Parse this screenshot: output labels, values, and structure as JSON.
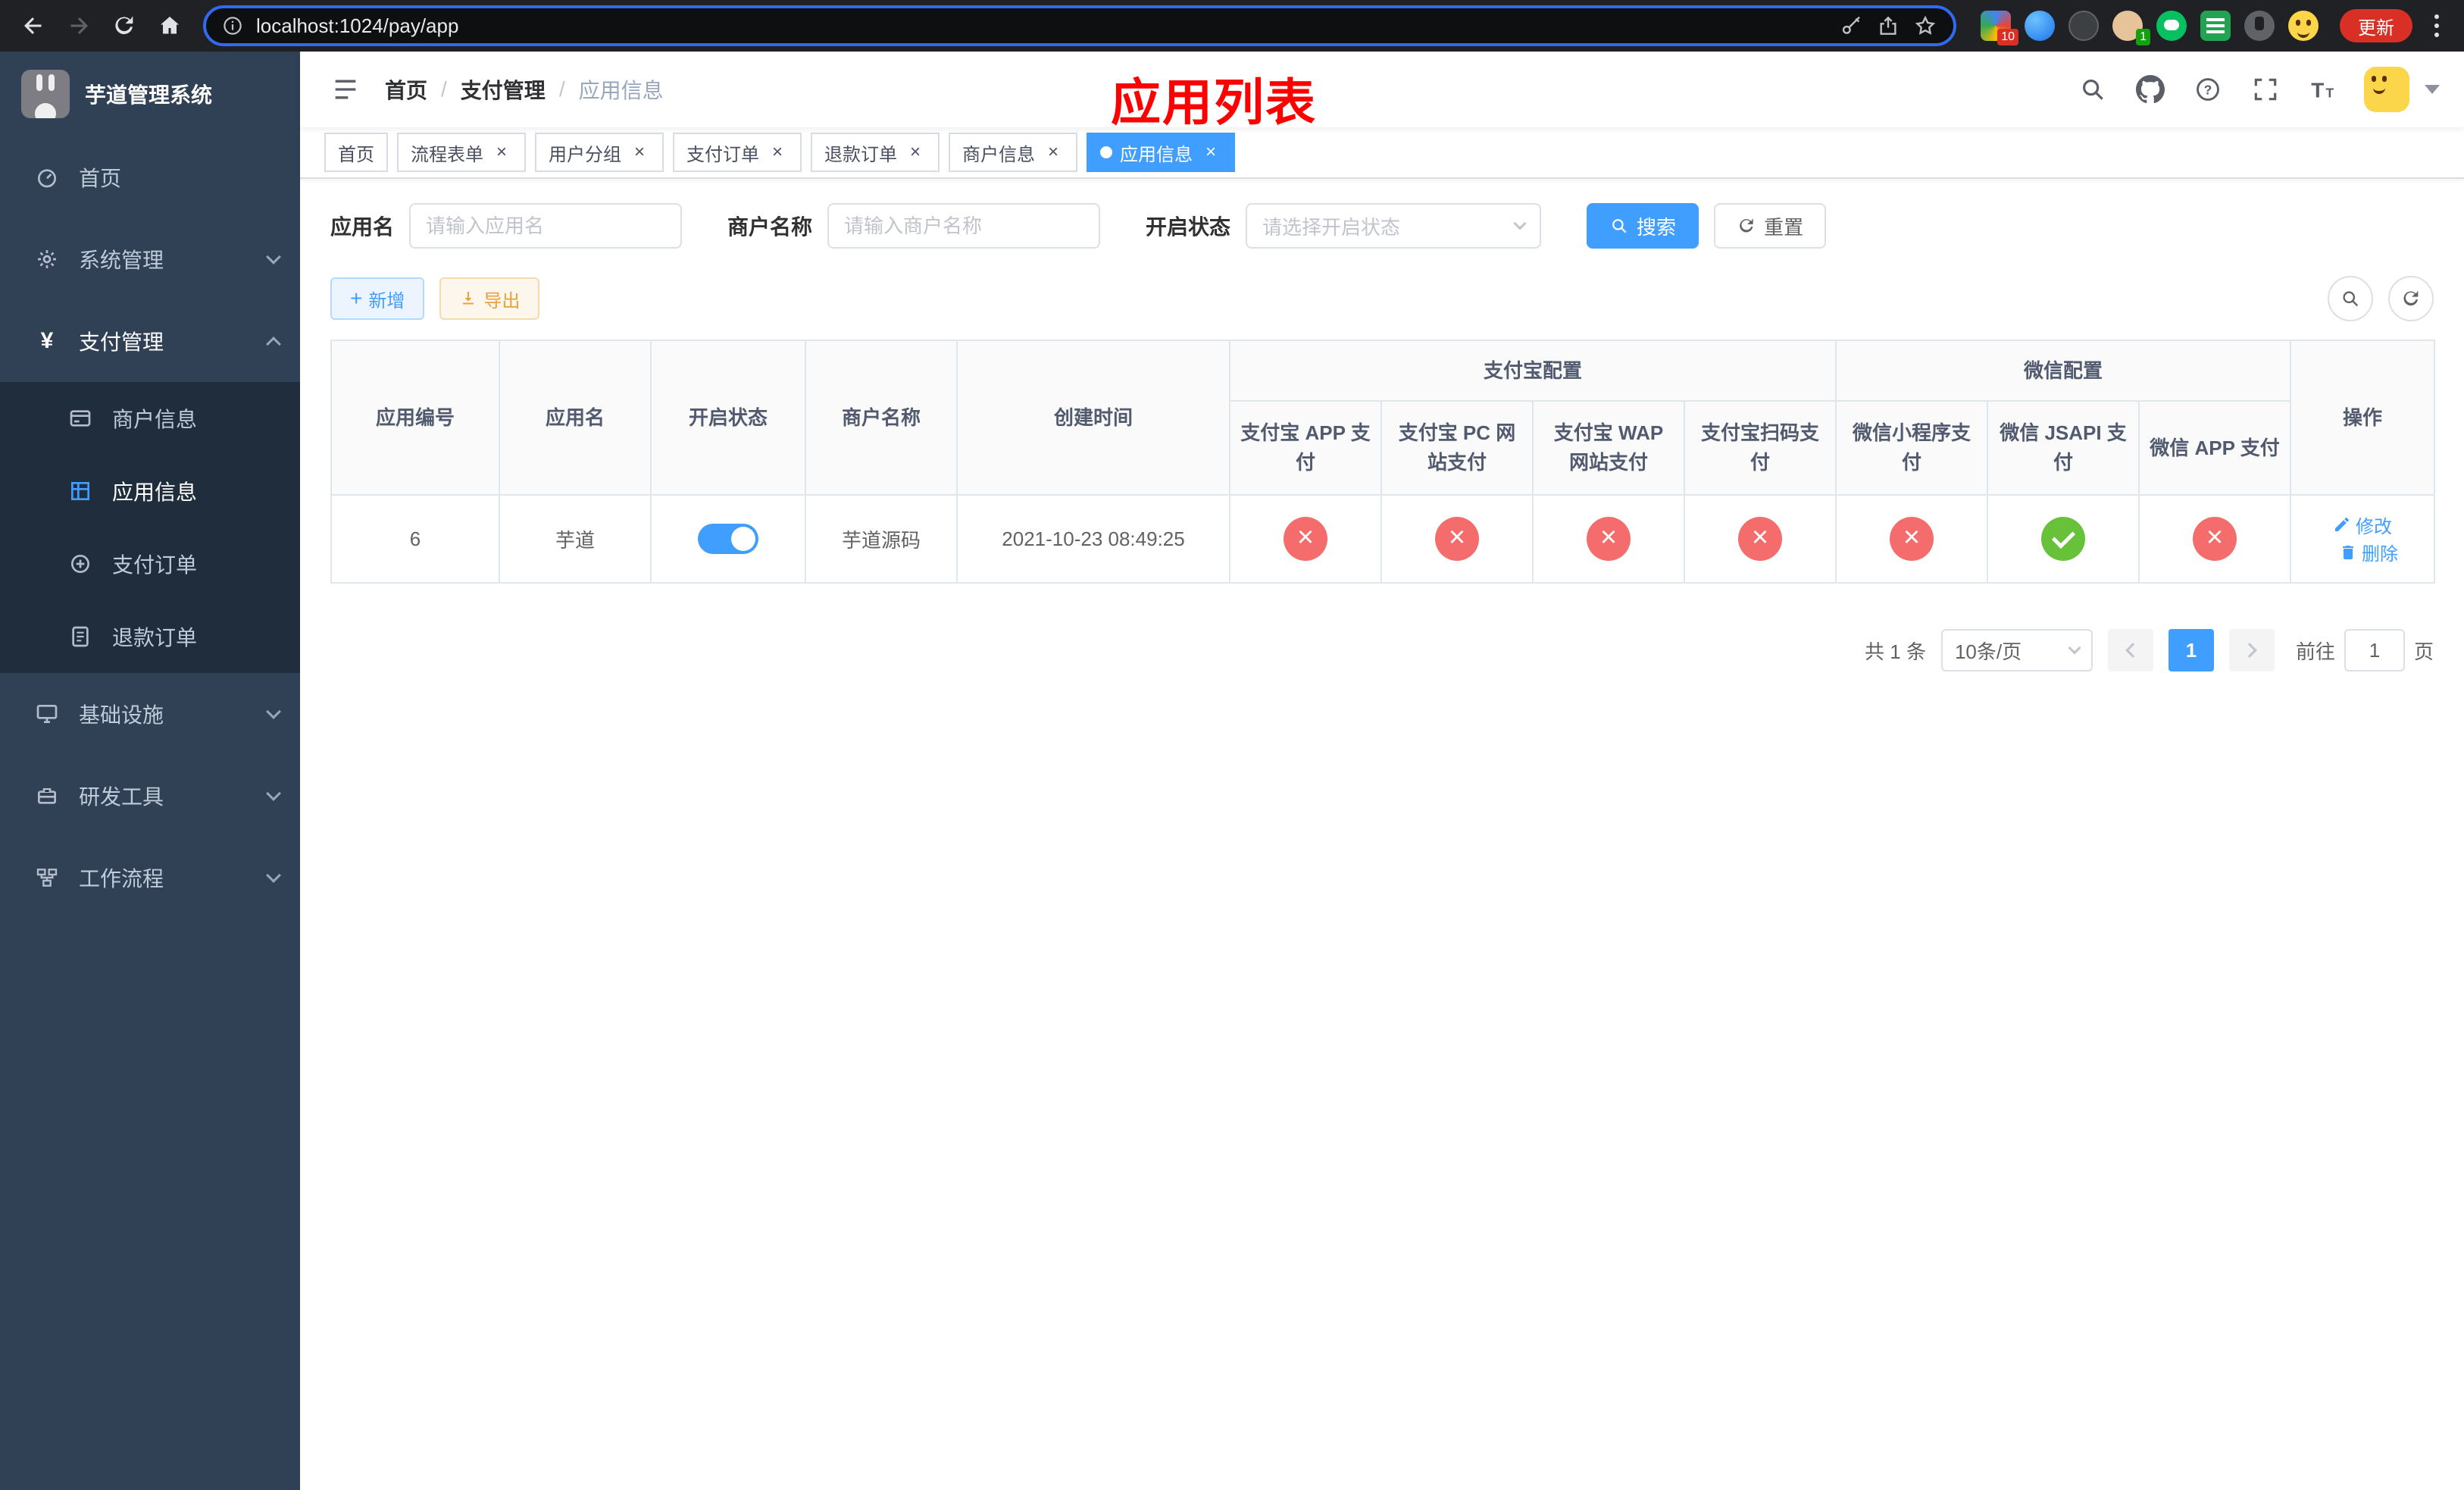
{
  "browser": {
    "url": "localhost:1024/pay/app",
    "update_label": "更新",
    "ext_badge_1": "10",
    "ext_badge_4": "1"
  },
  "sidebar": {
    "logo_title": "芋道管理系统",
    "items": [
      {
        "label": "首页"
      },
      {
        "label": "系统管理"
      },
      {
        "label": "支付管理"
      },
      {
        "label": "基础设施"
      },
      {
        "label": "研发工具"
      },
      {
        "label": "工作流程"
      }
    ],
    "pay_children": [
      {
        "label": "商户信息"
      },
      {
        "label": "应用信息"
      },
      {
        "label": "支付订单"
      },
      {
        "label": "退款订单"
      }
    ]
  },
  "header": {
    "breadcrumb": [
      "首页",
      "支付管理",
      "应用信息"
    ],
    "annotation": "应用列表"
  },
  "tabs": [
    {
      "label": "首页",
      "closable": false,
      "active": false
    },
    {
      "label": "流程表单",
      "closable": true,
      "active": false
    },
    {
      "label": "用户分组",
      "closable": true,
      "active": false
    },
    {
      "label": "支付订单",
      "closable": true,
      "active": false
    },
    {
      "label": "退款订单",
      "closable": true,
      "active": false
    },
    {
      "label": "商户信息",
      "closable": true,
      "active": false
    },
    {
      "label": "应用信息",
      "closable": true,
      "active": true
    }
  ],
  "filters": {
    "app_name_label": "应用名",
    "app_name_placeholder": "请输入应用名",
    "merchant_label": "商户名称",
    "merchant_placeholder": "请输入商户名称",
    "status_label": "开启状态",
    "status_placeholder": "请选择开启状态",
    "search_label": "搜索",
    "reset_label": "重置"
  },
  "toolbar": {
    "add_label": "新增",
    "export_label": "导出"
  },
  "table": {
    "headers": {
      "app_id": "应用编号",
      "app_name": "应用名",
      "status": "开启状态",
      "merchant": "商户名称",
      "create_time": "创建时间",
      "alipay_group": "支付宝配置",
      "wechat_group": "微信配置",
      "actions": "操作",
      "sub": [
        "支付宝 APP 支付",
        "支付宝 PC 网站支付",
        "支付宝 WAP 网站支付",
        "支付宝扫码支付",
        "微信小程序支付",
        "微信 JSAPI 支付",
        "微信 APP 支付"
      ]
    },
    "rows": [
      {
        "app_id": "6",
        "app_name": "芋道",
        "status_on": true,
        "merchant": "芋道源码",
        "create_time": "2021-10-23 08:49:25",
        "configs": [
          "cross",
          "cross",
          "cross",
          "cross",
          "cross",
          "check",
          "cross"
        ],
        "edit_label": "修改",
        "delete_label": "删除"
      }
    ]
  },
  "pagination": {
    "total_text": "共 1 条",
    "page_size_text": "10条/页",
    "current_page": "1",
    "goto_prefix": "前往",
    "goto_value": "1",
    "goto_suffix": "页"
  },
  "colors": {
    "primary": "#409eff",
    "success": "#67c23a",
    "danger": "#f56c6c",
    "warning": "#e6a23c",
    "sidebar_bg": "#304156",
    "submenu_bg": "#1f2d3d",
    "annotation_red": "#ff0000"
  }
}
